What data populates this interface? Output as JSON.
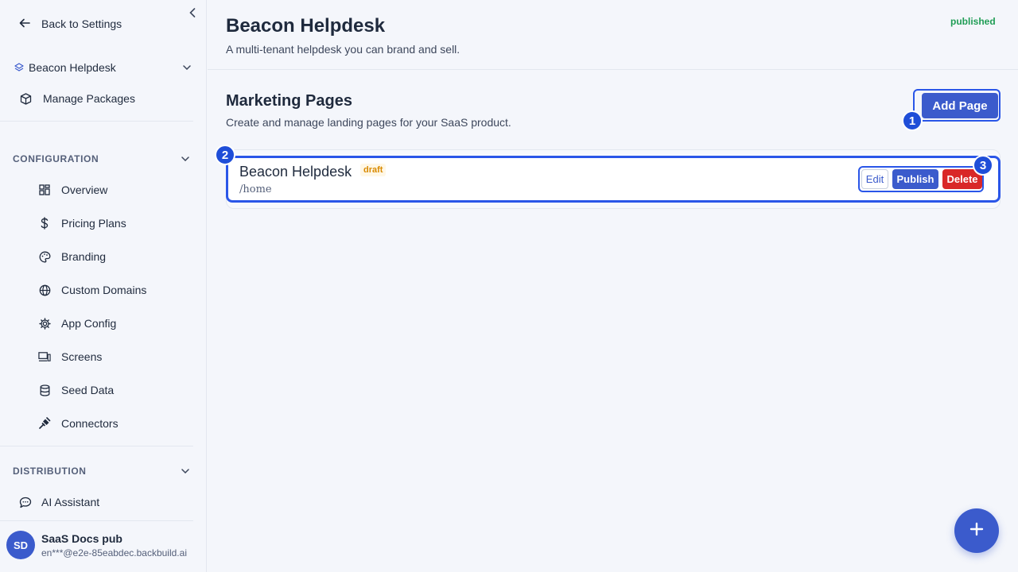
{
  "sidebar": {
    "back_label": "Back to Settings",
    "app_switcher_label": "Beacon Helpdesk",
    "manage_packages_label": "Manage Packages",
    "configuration_heading": "CONFIGURATION",
    "config_items": [
      {
        "label": "Overview",
        "icon": "grid-icon"
      },
      {
        "label": "Pricing Plans",
        "icon": "dollar-icon"
      },
      {
        "label": "Branding",
        "icon": "palette-icon"
      },
      {
        "label": "Custom Domains",
        "icon": "globe-icon"
      },
      {
        "label": "App Config",
        "icon": "gear-icon"
      },
      {
        "label": "Screens",
        "icon": "monitor-icon"
      },
      {
        "label": "Seed Data",
        "icon": "database-icon"
      },
      {
        "label": "Connectors",
        "icon": "plug-icon"
      }
    ],
    "distribution_heading": "DISTRIBUTION",
    "ai_assistant_label": "AI Assistant",
    "user": {
      "initials": "SD",
      "name": "SaaS Docs pub",
      "email": "en***@e2e-85eabdec.backbuild.ai"
    }
  },
  "header": {
    "title": "Beacon Helpdesk",
    "description": "A multi-tenant helpdesk you can brand and sell.",
    "status": "published"
  },
  "section": {
    "title": "Marketing Pages",
    "description": "Create and manage landing pages for your SaaS product.",
    "add_button_label": "Add Page"
  },
  "pages": [
    {
      "name": "Beacon Helpdesk",
      "status": "draft",
      "path": "/home",
      "edit_label": "Edit",
      "publish_label": "Publish",
      "delete_label": "Delete"
    }
  ],
  "annotations": [
    "1",
    "2",
    "3"
  ],
  "colors": {
    "primary": "#3b5bcc",
    "highlight": "#2a56e8",
    "danger": "#d92828",
    "success": "#1f9d55",
    "draft": "#d98a00"
  }
}
